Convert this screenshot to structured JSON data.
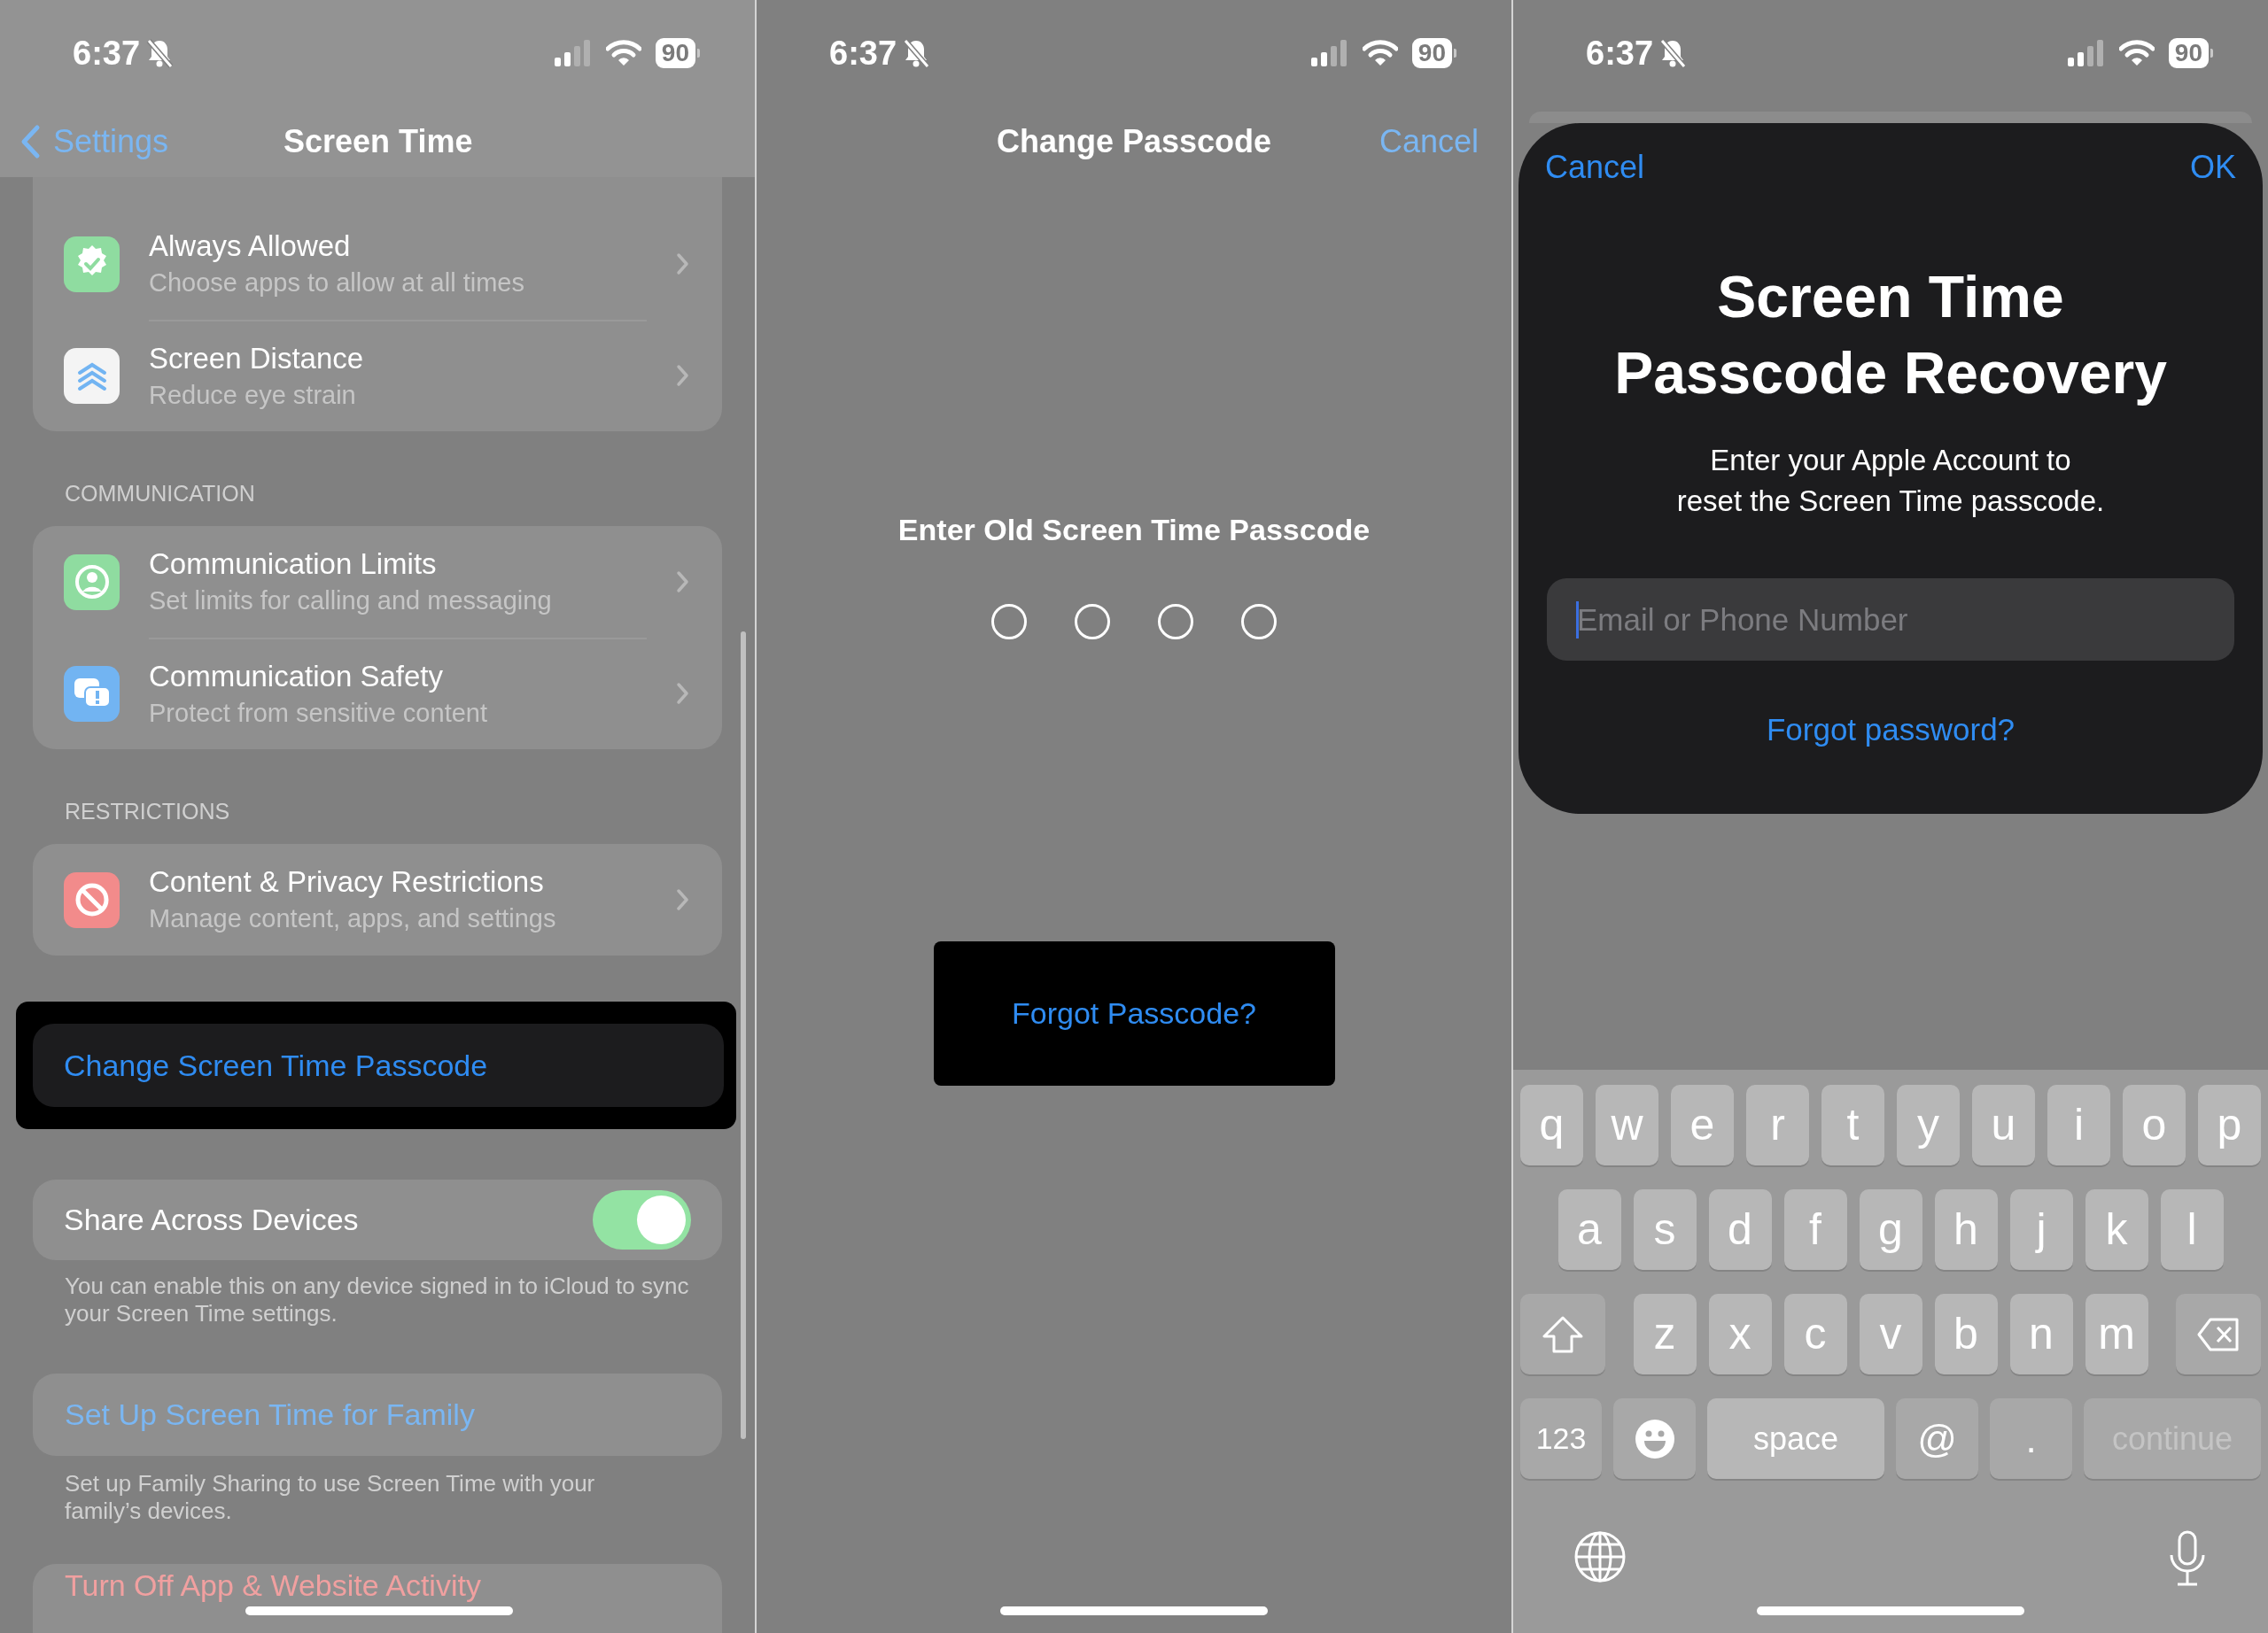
{
  "settings_screen": {
    "status_bar": {
      "time": "6:37",
      "battery": "90"
    },
    "nav": {
      "back": "Settings",
      "title": "Screen Time"
    },
    "groups": [
      {
        "rows": [
          {
            "title": "Always Allowed",
            "subtitle": "Choose apps to allow at all times",
            "color": "#8fdca0"
          },
          {
            "title": "Screen Distance",
            "subtitle": "Reduce eye strain",
            "color": "#f4f4f4"
          }
        ]
      },
      {
        "header": "COMMUNICATION",
        "rows": [
          {
            "title": "Communication Limits",
            "subtitle": "Set limits for calling and messaging",
            "color": "#8fdca0"
          },
          {
            "title": "Communication Safety",
            "subtitle": "Protect from sensitive content",
            "color": "#72b4f2"
          }
        ]
      },
      {
        "header": "RESTRICTIONS",
        "rows": [
          {
            "title": "Content & Privacy Restrictions",
            "subtitle": "Manage content, apps, and settings",
            "color": "#f28b8b"
          }
        ]
      }
    ],
    "change_passcode": {
      "label": "Change Screen Time Passcode",
      "highlighted": true
    },
    "share": {
      "label": "Share Across Devices",
      "on": true
    },
    "share_footer": "You can enable this on any device signed in to iCloud to sync your Screen Time settings.",
    "family_button": "Set Up Screen Time for Family",
    "family_footer": "Set up Family Sharing to use Screen Time with your family’s devices.",
    "turn_off_button": "Turn Off App & Website Activity"
  },
  "passcode_screen": {
    "status_bar": {
      "time": "6:37",
      "battery": "90"
    },
    "title": "Change Passcode",
    "cancel": "Cancel",
    "prompt": "Enter Old Screen Time Passcode",
    "digits": [
      {
        "filled": false
      },
      {
        "filled": false
      },
      {
        "filled": false
      },
      {
        "filled": false
      }
    ],
    "forgot": {
      "label": "Forgot Passcode?",
      "highlighted": true
    }
  },
  "recovery_screen": {
    "status_bar": {
      "time": "6:37",
      "battery": "90"
    },
    "cancel": "Cancel",
    "ok": "OK",
    "title": "Screen Time\nPasscode Recovery",
    "description": "Enter your Apple Account to\nreset the Screen Time passcode.",
    "field": {
      "placeholder": "Email or Phone Number"
    },
    "forgot": "Forgot password?",
    "keyboard": {
      "letter_rows": [
        [
          "q",
          "w",
          "e",
          "r",
          "t",
          "y",
          "u",
          "i",
          "o",
          "p"
        ],
        [
          "a",
          "s",
          "d",
          "f",
          "g",
          "h",
          "j",
          "k",
          "l"
        ],
        [
          "z",
          "x",
          "c",
          "v",
          "b",
          "n",
          "m"
        ]
      ],
      "bottom_row": [
        {
          "kind": "mode",
          "label": "123"
        },
        {
          "kind": "emoji"
        },
        {
          "kind": "space",
          "label": "space"
        },
        {
          "kind": "key",
          "label": "@"
        },
        {
          "kind": "key",
          "label": "."
        },
        {
          "kind": "return",
          "label": "continue",
          "disabled": true
        }
      ]
    }
  }
}
